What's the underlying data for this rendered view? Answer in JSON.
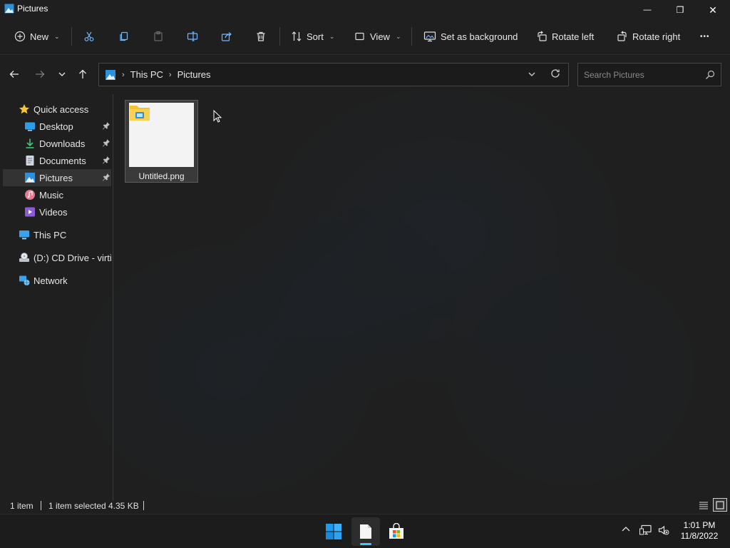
{
  "window": {
    "title": "Pictures",
    "minimize_glyph": "—",
    "maximize_glyph": "❐",
    "close_glyph": "✕"
  },
  "toolbar": {
    "new_label": "New",
    "sort_label": "Sort",
    "view_label": "View",
    "set_background_label": "Set as background",
    "rotate_left_label": "Rotate left",
    "rotate_right_label": "Rotate right",
    "more_glyph": "•••"
  },
  "address": {
    "segments": [
      "This PC",
      "Pictures"
    ]
  },
  "search": {
    "placeholder": "Search Pictures"
  },
  "sidebar": {
    "items": [
      {
        "label": "Quick access",
        "icon": "star-icon"
      },
      {
        "label": "Desktop",
        "icon": "desktop-icon",
        "pinned": true
      },
      {
        "label": "Downloads",
        "icon": "download-icon",
        "pinned": true
      },
      {
        "label": "Documents",
        "icon": "document-icon",
        "pinned": true
      },
      {
        "label": "Pictures",
        "icon": "pictures-icon",
        "pinned": true,
        "selected": true
      },
      {
        "label": "Music",
        "icon": "music-icon"
      },
      {
        "label": "Videos",
        "icon": "video-icon"
      },
      {
        "label": "This PC",
        "icon": "pc-icon"
      },
      {
        "label": "(D:) CD Drive - virtio-win",
        "icon": "cd-drive-icon"
      },
      {
        "label": "Network",
        "icon": "network-icon"
      }
    ]
  },
  "files": [
    {
      "name": "Untitled.png",
      "selected": true
    }
  ],
  "status": {
    "item_count": "1 item",
    "selection": "1 item selected",
    "size": "4.35 KB"
  },
  "taskbar": {
    "time": "1:01 PM",
    "date": "11/8/2022",
    "tray_chevron": "^"
  },
  "colors": {
    "accent": "#4cc2ff",
    "folder": "#f2c230",
    "start_blue": "#1e9bf0"
  }
}
